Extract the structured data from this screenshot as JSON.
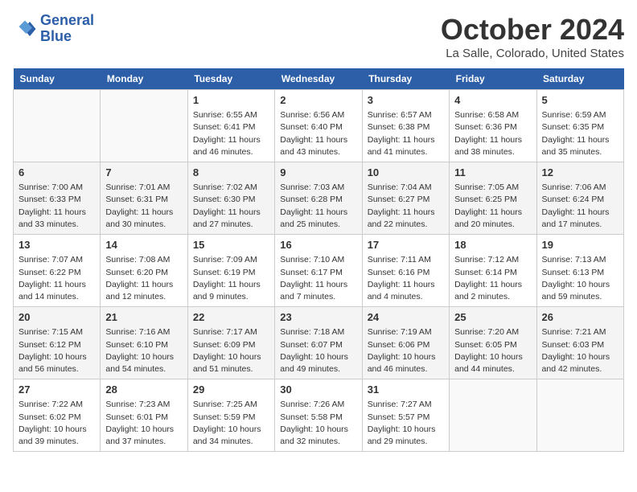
{
  "header": {
    "logo_line1": "General",
    "logo_line2": "Blue",
    "month_title": "October 2024",
    "location": "La Salle, Colorado, United States"
  },
  "weekdays": [
    "Sunday",
    "Monday",
    "Tuesday",
    "Wednesday",
    "Thursday",
    "Friday",
    "Saturday"
  ],
  "weeks": [
    [
      {
        "day": "",
        "info": ""
      },
      {
        "day": "",
        "info": ""
      },
      {
        "day": "1",
        "info": "Sunrise: 6:55 AM\nSunset: 6:41 PM\nDaylight: 11 hours and 46 minutes."
      },
      {
        "day": "2",
        "info": "Sunrise: 6:56 AM\nSunset: 6:40 PM\nDaylight: 11 hours and 43 minutes."
      },
      {
        "day": "3",
        "info": "Sunrise: 6:57 AM\nSunset: 6:38 PM\nDaylight: 11 hours and 41 minutes."
      },
      {
        "day": "4",
        "info": "Sunrise: 6:58 AM\nSunset: 6:36 PM\nDaylight: 11 hours and 38 minutes."
      },
      {
        "day": "5",
        "info": "Sunrise: 6:59 AM\nSunset: 6:35 PM\nDaylight: 11 hours and 35 minutes."
      }
    ],
    [
      {
        "day": "6",
        "info": "Sunrise: 7:00 AM\nSunset: 6:33 PM\nDaylight: 11 hours and 33 minutes."
      },
      {
        "day": "7",
        "info": "Sunrise: 7:01 AM\nSunset: 6:31 PM\nDaylight: 11 hours and 30 minutes."
      },
      {
        "day": "8",
        "info": "Sunrise: 7:02 AM\nSunset: 6:30 PM\nDaylight: 11 hours and 27 minutes."
      },
      {
        "day": "9",
        "info": "Sunrise: 7:03 AM\nSunset: 6:28 PM\nDaylight: 11 hours and 25 minutes."
      },
      {
        "day": "10",
        "info": "Sunrise: 7:04 AM\nSunset: 6:27 PM\nDaylight: 11 hours and 22 minutes."
      },
      {
        "day": "11",
        "info": "Sunrise: 7:05 AM\nSunset: 6:25 PM\nDaylight: 11 hours and 20 minutes."
      },
      {
        "day": "12",
        "info": "Sunrise: 7:06 AM\nSunset: 6:24 PM\nDaylight: 11 hours and 17 minutes."
      }
    ],
    [
      {
        "day": "13",
        "info": "Sunrise: 7:07 AM\nSunset: 6:22 PM\nDaylight: 11 hours and 14 minutes."
      },
      {
        "day": "14",
        "info": "Sunrise: 7:08 AM\nSunset: 6:20 PM\nDaylight: 11 hours and 12 minutes."
      },
      {
        "day": "15",
        "info": "Sunrise: 7:09 AM\nSunset: 6:19 PM\nDaylight: 11 hours and 9 minutes."
      },
      {
        "day": "16",
        "info": "Sunrise: 7:10 AM\nSunset: 6:17 PM\nDaylight: 11 hours and 7 minutes."
      },
      {
        "day": "17",
        "info": "Sunrise: 7:11 AM\nSunset: 6:16 PM\nDaylight: 11 hours and 4 minutes."
      },
      {
        "day": "18",
        "info": "Sunrise: 7:12 AM\nSunset: 6:14 PM\nDaylight: 11 hours and 2 minutes."
      },
      {
        "day": "19",
        "info": "Sunrise: 7:13 AM\nSunset: 6:13 PM\nDaylight: 10 hours and 59 minutes."
      }
    ],
    [
      {
        "day": "20",
        "info": "Sunrise: 7:15 AM\nSunset: 6:12 PM\nDaylight: 10 hours and 56 minutes."
      },
      {
        "day": "21",
        "info": "Sunrise: 7:16 AM\nSunset: 6:10 PM\nDaylight: 10 hours and 54 minutes."
      },
      {
        "day": "22",
        "info": "Sunrise: 7:17 AM\nSunset: 6:09 PM\nDaylight: 10 hours and 51 minutes."
      },
      {
        "day": "23",
        "info": "Sunrise: 7:18 AM\nSunset: 6:07 PM\nDaylight: 10 hours and 49 minutes."
      },
      {
        "day": "24",
        "info": "Sunrise: 7:19 AM\nSunset: 6:06 PM\nDaylight: 10 hours and 46 minutes."
      },
      {
        "day": "25",
        "info": "Sunrise: 7:20 AM\nSunset: 6:05 PM\nDaylight: 10 hours and 44 minutes."
      },
      {
        "day": "26",
        "info": "Sunrise: 7:21 AM\nSunset: 6:03 PM\nDaylight: 10 hours and 42 minutes."
      }
    ],
    [
      {
        "day": "27",
        "info": "Sunrise: 7:22 AM\nSunset: 6:02 PM\nDaylight: 10 hours and 39 minutes."
      },
      {
        "day": "28",
        "info": "Sunrise: 7:23 AM\nSunset: 6:01 PM\nDaylight: 10 hours and 37 minutes."
      },
      {
        "day": "29",
        "info": "Sunrise: 7:25 AM\nSunset: 5:59 PM\nDaylight: 10 hours and 34 minutes."
      },
      {
        "day": "30",
        "info": "Sunrise: 7:26 AM\nSunset: 5:58 PM\nDaylight: 10 hours and 32 minutes."
      },
      {
        "day": "31",
        "info": "Sunrise: 7:27 AM\nSunset: 5:57 PM\nDaylight: 10 hours and 29 minutes."
      },
      {
        "day": "",
        "info": ""
      },
      {
        "day": "",
        "info": ""
      }
    ]
  ]
}
